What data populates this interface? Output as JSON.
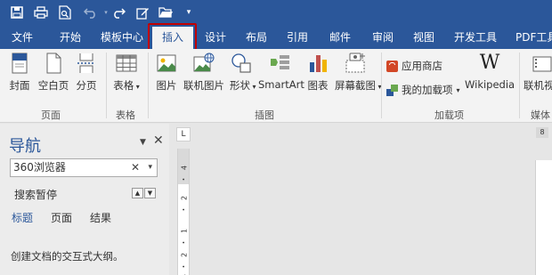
{
  "qat": {
    "icons": [
      "save-icon",
      "print-icon",
      "print-preview-icon",
      "undo-icon",
      "redo-icon",
      "edit-icon",
      "open-folder-icon",
      "customize-icon"
    ]
  },
  "tabs": [
    {
      "label": "文件"
    },
    {
      "label": "开始"
    },
    {
      "label": "模板中心"
    },
    {
      "label": "插入"
    },
    {
      "label": "设计"
    },
    {
      "label": "布局"
    },
    {
      "label": "引用"
    },
    {
      "label": "邮件"
    },
    {
      "label": "审阅"
    },
    {
      "label": "视图"
    },
    {
      "label": "开发工具"
    },
    {
      "label": "PDF工具"
    }
  ],
  "ribbon": {
    "cover": "封面",
    "blank_page": "空白页",
    "page_break": "分页",
    "group_pages": "页面",
    "table": "表格",
    "group_table": "表格",
    "picture": "图片",
    "online_picture": "联机图片",
    "shapes": "形状",
    "smartart": "SmartArt",
    "chart": "图表",
    "screenshot": "屏幕截图",
    "group_illustrations": "插图",
    "app_store": "应用商店",
    "my_addins": "我的加载项",
    "wikipedia": "Wikipedia",
    "group_addins": "加载项",
    "online_video": "联机视",
    "group_media": "媒体"
  },
  "nav": {
    "title": "导航",
    "search_value": "360浏览器",
    "paused": "搜索暂停",
    "tab_headings": "标题",
    "tab_pages": "页面",
    "tab_results": "结果",
    "description": "创建文档的交互式大纲。"
  },
  "doc": {
    "page_number": "8",
    "ruler_ticks": [
      "4",
      "2",
      "1",
      "2",
      "4"
    ]
  },
  "colors": {
    "brand": "#2b579a",
    "highlight": "#c00000"
  }
}
